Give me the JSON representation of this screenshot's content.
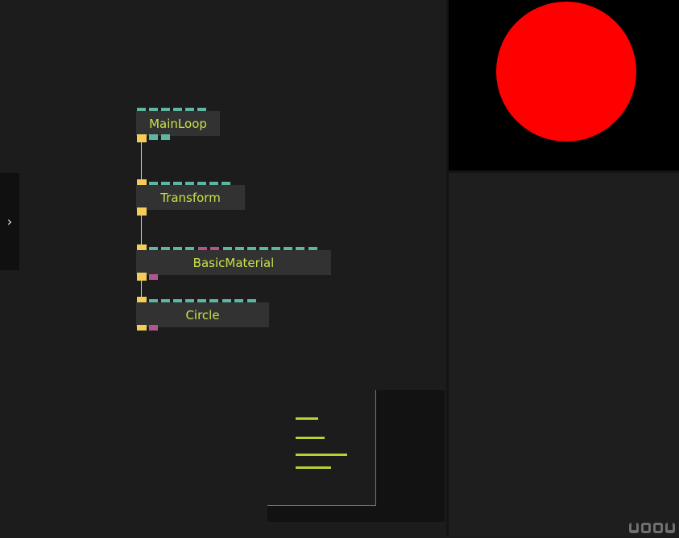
{
  "nodes": [
    {
      "label": "MainLoop"
    },
    {
      "label": "Transform"
    },
    {
      "label": "BasicMaterial"
    },
    {
      "label": "Circle"
    }
  ],
  "sidebar": {
    "toggle_glyph": "›"
  },
  "preview": {
    "shape": "circle",
    "color": "#ff0000",
    "background": "#000000"
  },
  "colors": {
    "node_label": "#c6e34a",
    "port_flow": "#f3cc5a",
    "port_input": "#5cb6a0",
    "port_material": "#b0568f"
  },
  "brand": {
    "logo_text": "UDGV"
  }
}
